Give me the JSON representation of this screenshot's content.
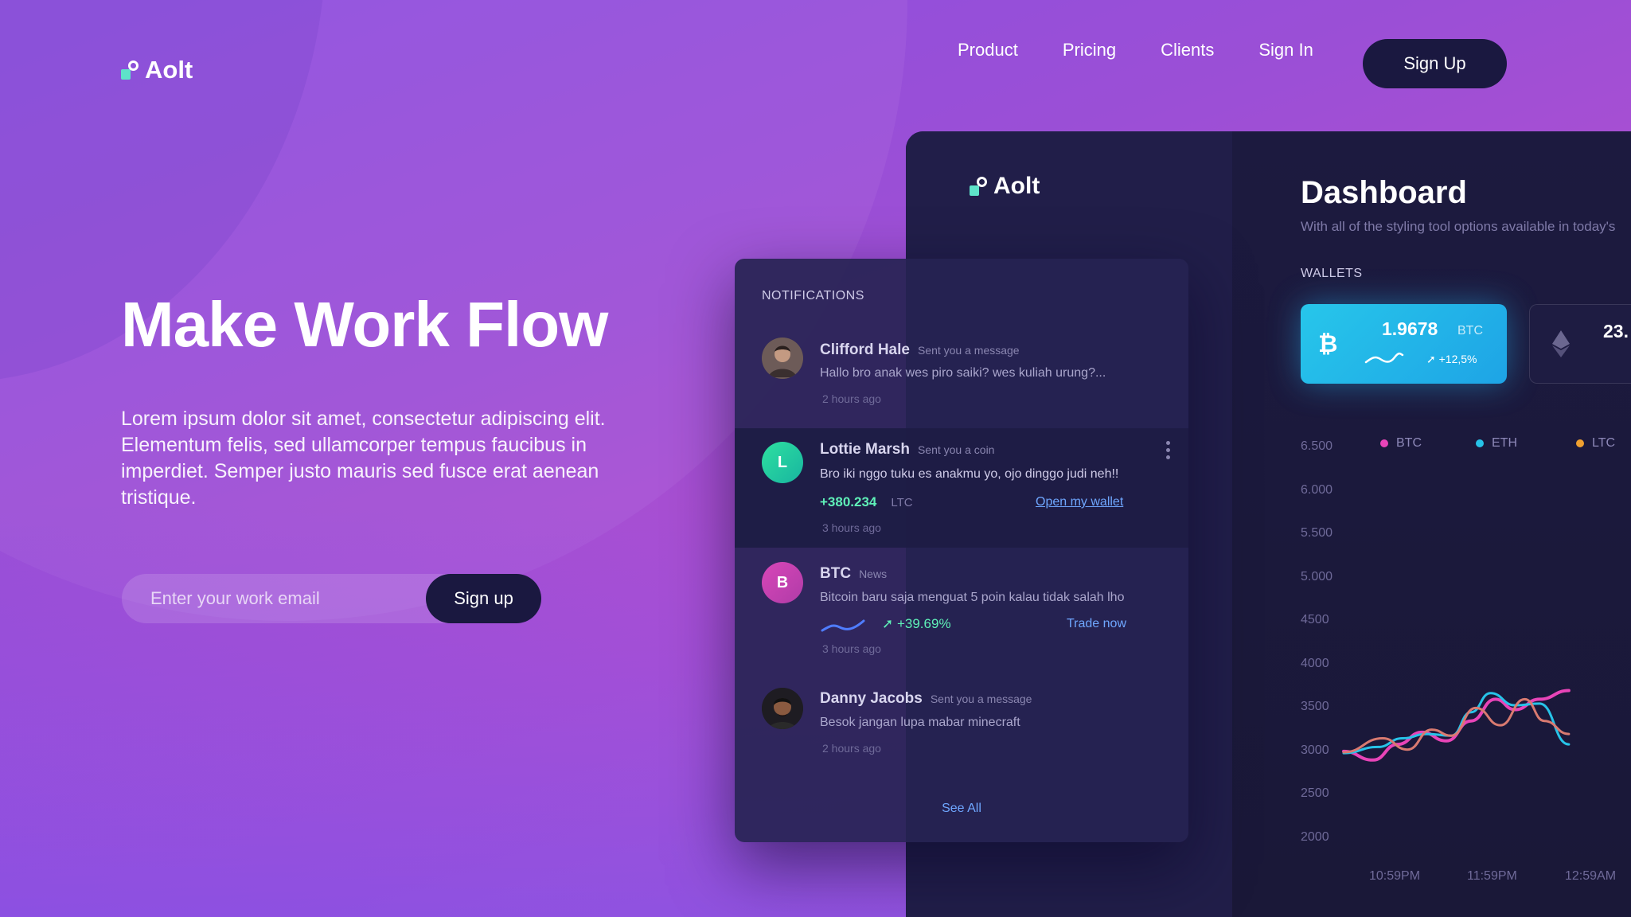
{
  "brand": {
    "name": "Aolt"
  },
  "nav": {
    "items": [
      "Product",
      "Pricing",
      "Clients",
      "Sign In"
    ],
    "signup_label": "Sign Up"
  },
  "hero": {
    "title": "Make Work Flow",
    "text": "Lorem ipsum dolor sit amet, consectetur adipiscing elit. Elementum felis, sed ullamcorper tempus faucibus in imperdiet. Semper justo mauris sed fusce erat aenean tristique.",
    "email_placeholder": "Enter your work email",
    "signup_button": "Sign up"
  },
  "dashboard": {
    "brand": "Aolt",
    "title": "Dashboard",
    "subtitle": "With all of the styling tool options available in today's",
    "wallets_label": "WALLETS",
    "wallets": [
      {
        "coin": "BTC",
        "amount": "1.9678",
        "unit": "BTC",
        "change": "+12,5%"
      },
      {
        "coin": "ETH",
        "amount": "23."
      }
    ]
  },
  "notifications": {
    "header": "NOTIFICATIONS",
    "items": [
      {
        "name": "Clifford Hale",
        "action": "Sent you a message",
        "message": "Hallo bro anak wes piro saiki? wes kuliah urung?...",
        "time": "2 hours ago"
      },
      {
        "name": "Lottie Marsh",
        "initial": "L",
        "action": "Sent you a coin",
        "message": "Bro iki nggo tuku es anakmu yo, ojo dinggo judi neh!!",
        "value": "+380.234",
        "unit": "LTC",
        "link": "Open my wallet",
        "time": "3 hours ago"
      },
      {
        "name": "BTC",
        "initial": "B",
        "action": "News",
        "message": "Bitcoin baru saja menguat 5 poin kalau tidak salah lho",
        "change": "+39.69%",
        "link": "Trade now",
        "time": "3 hours ago"
      },
      {
        "name": "Danny Jacobs",
        "action": "Sent you a message",
        "message": "Besok jangan lupa mabar minecraft",
        "time": "2 hours ago"
      }
    ],
    "see_all": "See All"
  },
  "colors": {
    "btc": "#e844b8",
    "eth": "#27c3e8",
    "ltc": "#f0a030",
    "accent_dark": "#1a1840",
    "teal": "#5ee3c9"
  },
  "chart_data": {
    "type": "line",
    "x": [
      "10:59PM",
      "11:59PM",
      "12:59AM"
    ],
    "y_ticks": [
      "6.500",
      "6.000",
      "5.500",
      "5.000",
      "4500",
      "4000",
      "3500",
      "3000",
      "2500",
      "2000"
    ],
    "legend": [
      "BTC",
      "ETH",
      "LTC"
    ],
    "series": [
      {
        "name": "BTC",
        "color": "#e844b8",
        "points": [
          [
            0,
            3000
          ],
          [
            0.3,
            2900
          ],
          [
            0.55,
            3080
          ],
          [
            0.8,
            3220
          ],
          [
            1.05,
            3120
          ],
          [
            1.3,
            3350
          ],
          [
            1.55,
            3600
          ],
          [
            1.75,
            3480
          ],
          [
            2.0,
            3600
          ],
          [
            2.3,
            3700
          ]
        ]
      },
      {
        "name": "ETH",
        "color": "#27c3e8",
        "points": [
          [
            0,
            2980
          ],
          [
            0.35,
            3050
          ],
          [
            0.6,
            3150
          ],
          [
            0.85,
            3200
          ],
          [
            1.1,
            3180
          ],
          [
            1.3,
            3450
          ],
          [
            1.5,
            3670
          ],
          [
            1.75,
            3530
          ],
          [
            2.0,
            3550
          ],
          [
            2.3,
            3080
          ]
        ]
      },
      {
        "name": "LTC",
        "color": "#d97a70",
        "points": [
          [
            0,
            2990
          ],
          [
            0.4,
            3150
          ],
          [
            0.65,
            3020
          ],
          [
            0.9,
            3250
          ],
          [
            1.1,
            3180
          ],
          [
            1.35,
            3500
          ],
          [
            1.6,
            3300
          ],
          [
            1.85,
            3600
          ],
          [
            2.05,
            3350
          ],
          [
            2.3,
            3200
          ]
        ]
      }
    ],
    "ylim": [
      2000,
      6500
    ]
  }
}
